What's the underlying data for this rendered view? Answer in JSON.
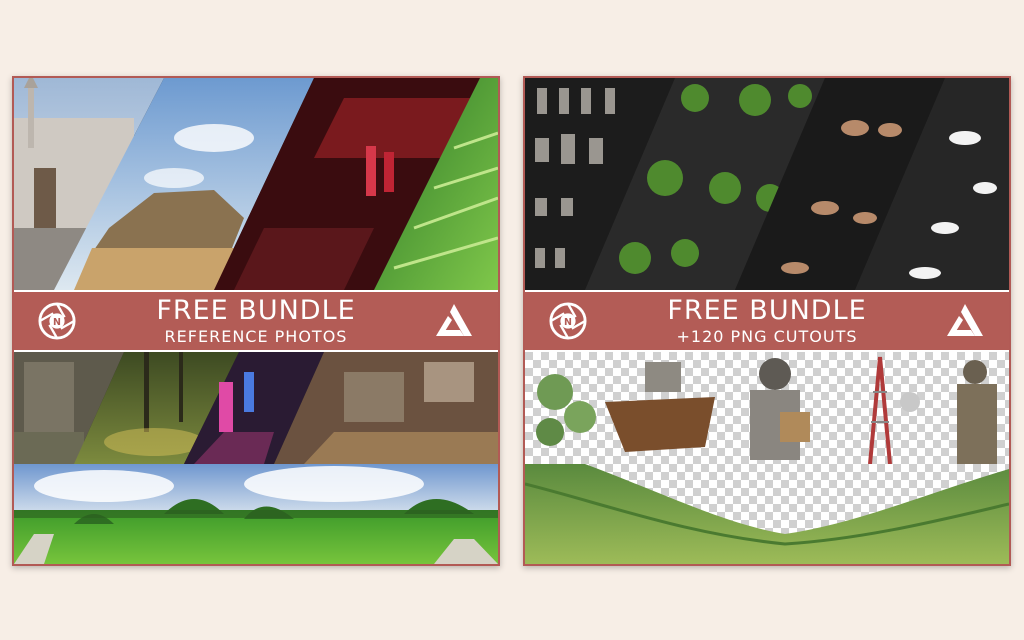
{
  "left_card": {
    "title": "FREE BUNDLE",
    "subtitle": "REFERENCE PHOTOS",
    "top_strip": [
      {
        "name": "mosque-photo"
      },
      {
        "name": "temple-photo"
      },
      {
        "name": "neon-street-photo"
      },
      {
        "name": "rice-terraces-photo"
      }
    ],
    "bottom_strip": [
      {
        "name": "concrete-ruin-photo"
      },
      {
        "name": "forest-photo"
      },
      {
        "name": "neon-alley-photo"
      },
      {
        "name": "abandoned-factory-photo"
      }
    ],
    "panorama": {
      "name": "rice-field-panorama"
    }
  },
  "right_card": {
    "title": "FREE BUNDLE",
    "subtitle": "+120 PNG CUTOUTS",
    "top_strip": [
      {
        "name": "armor-cutouts"
      },
      {
        "name": "plant-cutouts"
      },
      {
        "name": "boat-cutouts"
      },
      {
        "name": "cloud-cutouts"
      }
    ],
    "bottom_strip": [
      {
        "name": "cactus-cutout"
      },
      {
        "name": "ship-cutout"
      },
      {
        "name": "knight-cutout"
      },
      {
        "name": "antenna-cutout"
      },
      {
        "name": "soldier-cutout"
      }
    ],
    "panorama": {
      "name": "valley-panorama"
    }
  },
  "colors": {
    "background": "#f7eee6",
    "band": "#b35c56",
    "border": "#b25a55"
  },
  "icons": [
    "aperture-n-icon",
    "artstation-icon"
  ]
}
